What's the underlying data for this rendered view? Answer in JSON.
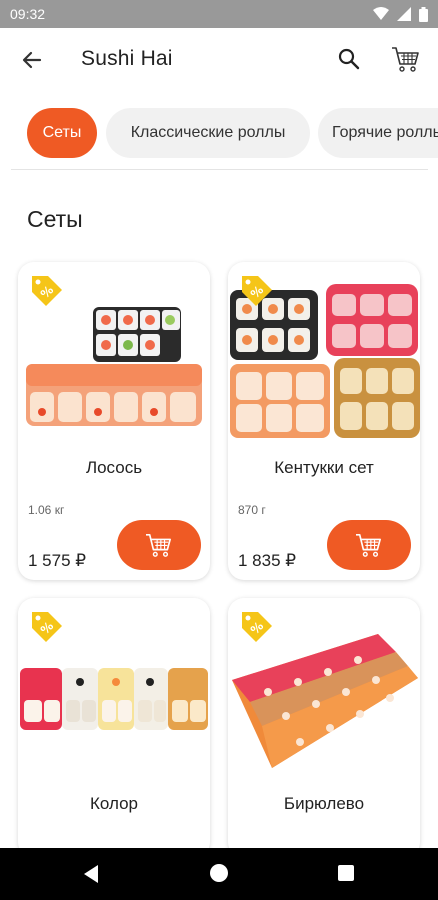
{
  "status_bar": {
    "time": "09:32"
  },
  "app_bar": {
    "title": "Sushi Hai"
  },
  "categories": [
    {
      "label": "Сеты",
      "active": true
    },
    {
      "label": "Классические роллы",
      "active": false
    },
    {
      "label": "Горячие роллы",
      "active": false
    }
  ],
  "section_title": "Сеты",
  "products": [
    {
      "name": "Лосось",
      "weight": "1.06 кг",
      "price": "1 575 ₽"
    },
    {
      "name": "Кентукки сет",
      "weight": "870 г",
      "price": "1 835 ₽"
    },
    {
      "name": "Колор"
    },
    {
      "name": "Бирюлево"
    }
  ],
  "colors": {
    "accent": "#ef5a24",
    "promo": "#f5c518",
    "status_bar": "#999999"
  }
}
